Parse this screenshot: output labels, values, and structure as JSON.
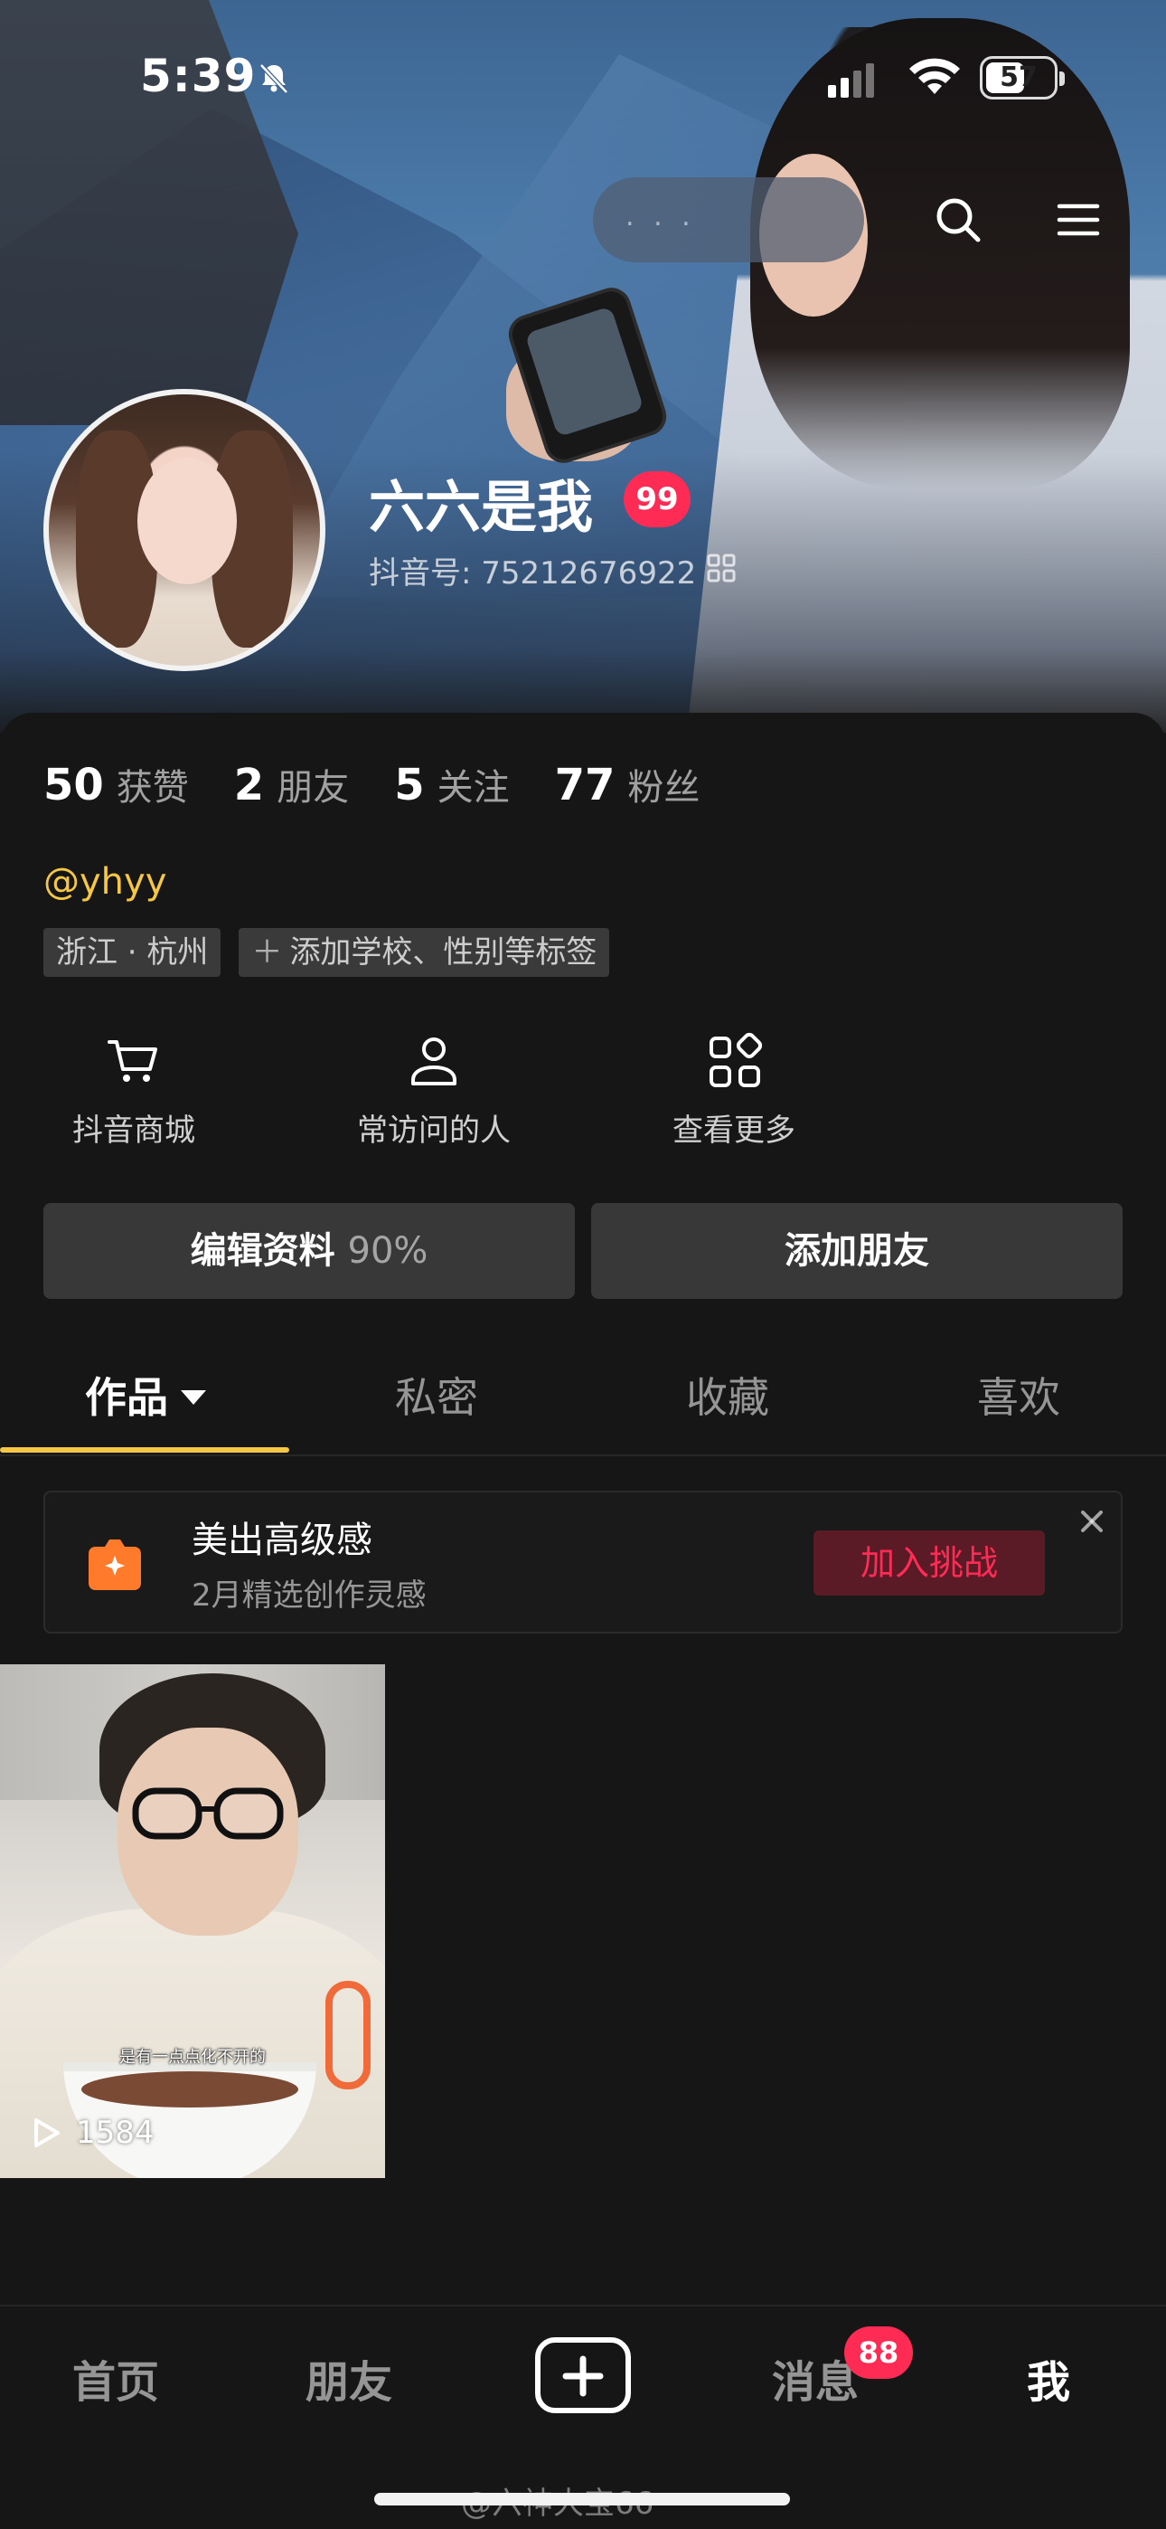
{
  "status_bar": {
    "time": "5:39",
    "battery": "57",
    "battery_level": 0.57
  },
  "header": {
    "search_placeholder": ". . ."
  },
  "profile": {
    "name": "六六是我",
    "level": "99",
    "douyin_id": "抖音号: 75212676922"
  },
  "stats": [
    {
      "num": "50",
      "label": "获赞"
    },
    {
      "num": "2",
      "label": "朋友"
    },
    {
      "num": "5",
      "label": "关注"
    },
    {
      "num": "77",
      "label": "粉丝"
    }
  ],
  "handle": "@yhyy",
  "tags": {
    "location": "浙江 · 杭州",
    "add": "添加学校、性别等标签"
  },
  "shortcuts": [
    {
      "label": "抖音商城",
      "icon": "cart-icon"
    },
    {
      "label": "常访问的人",
      "icon": "person-icon"
    },
    {
      "label": "查看更多",
      "icon": "grid-icon"
    }
  ],
  "actions": {
    "edit": "编辑资料",
    "edit_pct": "90%",
    "add_friend": "添加朋友"
  },
  "tabs": [
    "作品",
    "私密",
    "收藏",
    "喜欢"
  ],
  "promo": {
    "title": "美出高级感",
    "subtitle": "2月精选创作灵感",
    "join": "加入挑战"
  },
  "video": {
    "caption": "是有一点点化不开的",
    "plays": "1584"
  },
  "bottom_nav": {
    "home": "首页",
    "friends": "朋友",
    "messages": "消息",
    "me": "我",
    "message_badge": "88"
  },
  "watermark": "@六神大宝66",
  "colors": {
    "accent_yellow": "#f5c744",
    "brand_red": "#fe2c55",
    "bg": "#161616"
  }
}
